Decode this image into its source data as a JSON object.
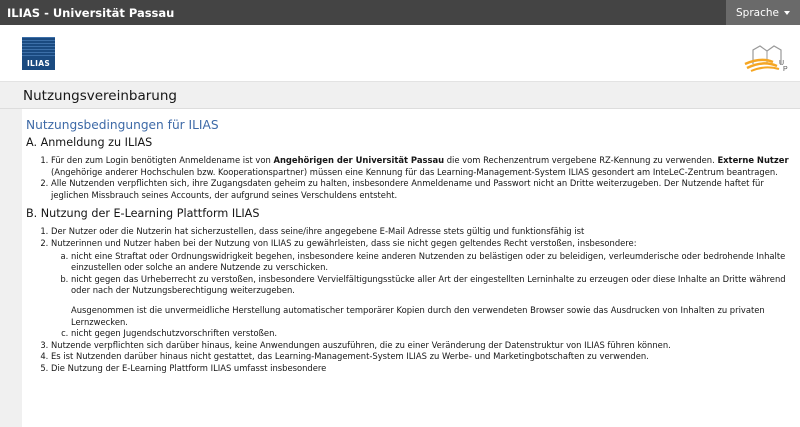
{
  "topbar": {
    "title": "ILIAS - Universität Passau",
    "language_label": "Sprache"
  },
  "logos": {
    "ilias": "ILIAS"
  },
  "page": {
    "title": "Nutzungsvereinbarung"
  },
  "doc": {
    "heading": "Nutzungsbedingungen für ILIAS",
    "secA_title": "A. Anmeldung zu ILIAS",
    "a1": {
      "p1": "Für den zum Login benötigten Anmeldename ist von ",
      "b1": "Angehörigen der Universität Passau",
      "p2": " die vom Rechenzentrum vergebene RZ-Kennung zu verwenden. ",
      "b2": "Externe Nutzer",
      "p3": " (Angehörige anderer Hochschulen bzw. Kooperationspartner) müssen eine Kennung für das Learning-Management-System ILIAS gesondert am InteLeC-Zentrum beantragen."
    },
    "a2": "Alle Nutzenden verpflichten sich, ihre Zugangsdaten geheim zu halten, insbesondere Anmeldename und Passwort nicht an Dritte weiterzugeben. Der Nutzende haftet für jeglichen Missbrauch seines Accounts, der aufgrund seines Verschuldens entsteht.",
    "secB_title": "B. Nutzung der E-Learning Plattform ILIAS",
    "b1": "Der Nutzer oder die Nutzerin hat sicherzustellen, dass seine/ihre angegebene E-Mail Adresse stets gültig und funktionsfähig ist",
    "b2": "Nutzerinnen und Nutzer haben bei der Nutzung von ILIAS zu gewährleisten, dass sie nicht gegen geltendes Recht verstoßen, insbesondere:",
    "b2a": "nicht eine Straftat oder Ordnungswidrigkeit begehen, insbesondere keine anderen Nutzenden zu belästigen oder zu beleidigen, verleumderische oder bedrohende Inhalte einzustellen oder solche an andere Nutzende zu verschicken.",
    "b2b": "nicht gegen das Urheberrecht zu verstoßen, insbesondere Vervielfältigungsstücke aller Art der eingestellten Lerninhalte zu erzeugen oder diese Inhalte an Dritte während oder nach der Nutzungsberechtigung weiterzugeben.",
    "b2b_note": "Ausgenommen ist die unvermeidliche Herstellung automatischer temporärer Kopien durch den verwendeten Browser sowie das Ausdrucken von Inhalten zu privaten Lernzwecken.",
    "b2c": "nicht gegen Jugendschutzvorschriften verstoßen.",
    "b3": "Nutzende verpflichten sich darüber hinaus, keine Anwendungen auszuführen, die zu einer Veränderung der Datenstruktur von ILIAS führen können.",
    "b4": "Es ist Nutzenden darüber hinaus nicht gestattet, das Learning-Management-System ILIAS zu Werbe- und Marketingbotschaften zu verwenden.",
    "b5": "Die Nutzung der E-Learning Plattform ILIAS umfasst insbesondere"
  }
}
